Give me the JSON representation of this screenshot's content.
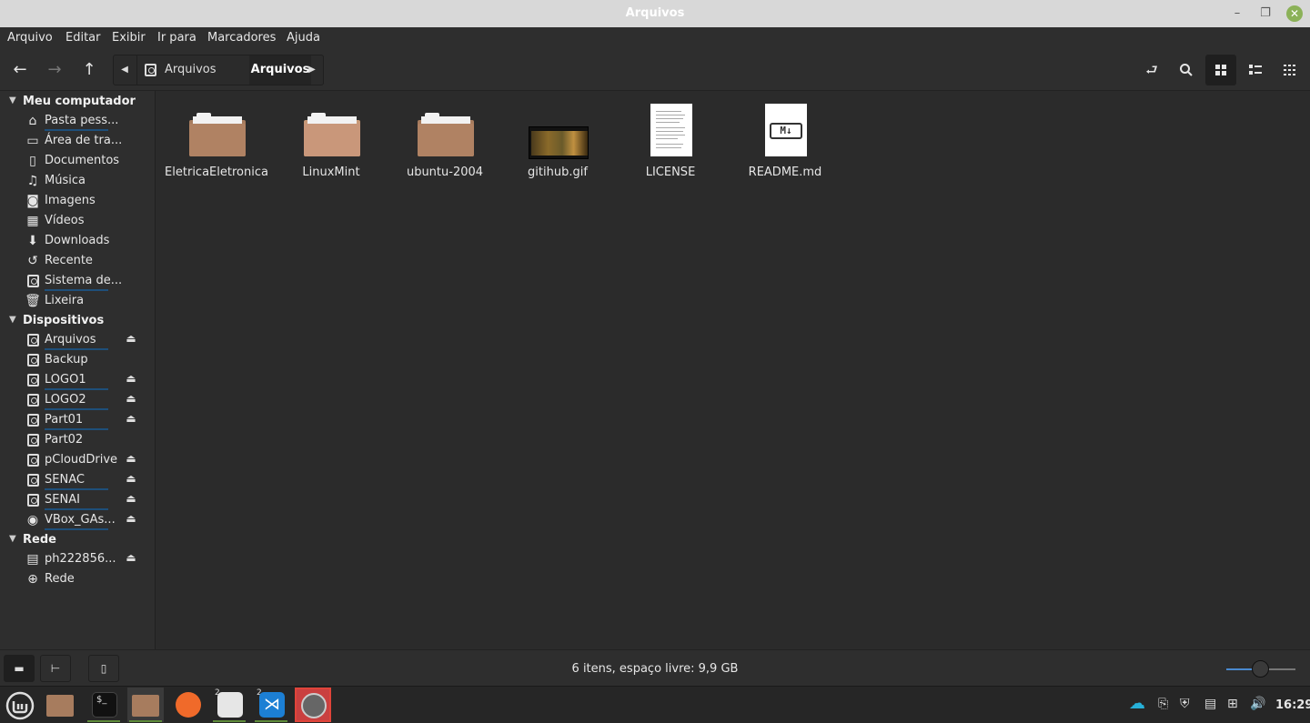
{
  "window": {
    "title": "Arquivos"
  },
  "menu": [
    "Arquivo",
    "Editar",
    "Exibir",
    "Ir para",
    "Marcadores",
    "Ajuda"
  ],
  "pathbar": {
    "segments": [
      "Arquivos",
      "Arquivos"
    ]
  },
  "sidebar": {
    "sections": [
      {
        "label": "Meu computador",
        "items": [
          {
            "label": "Pasta pess...",
            "icon": "home-icon"
          },
          {
            "label": "Área de tra...",
            "icon": "desktop-icon"
          },
          {
            "label": "Documentos",
            "icon": "documents-icon"
          },
          {
            "label": "Música",
            "icon": "music-icon"
          },
          {
            "label": "Imagens",
            "icon": "camera-icon"
          },
          {
            "label": "Vídeos",
            "icon": "video-icon"
          },
          {
            "label": "Downloads",
            "icon": "download-icon"
          },
          {
            "label": "Recente",
            "icon": "history-icon"
          },
          {
            "label": "Sistema de...",
            "icon": "drive-icon"
          },
          {
            "label": "Lixeira",
            "icon": "trash-icon"
          }
        ]
      },
      {
        "label": "Dispositivos",
        "items": [
          {
            "label": "Arquivos",
            "icon": "drive-icon"
          },
          {
            "label": "Backup",
            "icon": "drive-icon"
          },
          {
            "label": "LOGO1",
            "icon": "drive-icon"
          },
          {
            "label": "LOGO2",
            "icon": "drive-icon"
          },
          {
            "label": "Part01",
            "icon": "drive-icon"
          },
          {
            "label": "Part02",
            "icon": "drive-icon"
          },
          {
            "label": "pCloudDrive",
            "icon": "drive-icon"
          },
          {
            "label": "SENAC",
            "icon": "drive-icon"
          },
          {
            "label": "SENAI",
            "icon": "drive-icon"
          },
          {
            "label": "VBox_GAs...",
            "icon": "optical-disc-icon"
          }
        ]
      },
      {
        "label": "Rede",
        "items": [
          {
            "label": "ph222856...",
            "icon": "server-icon"
          },
          {
            "label": "Rede",
            "icon": "network-icon"
          }
        ]
      }
    ]
  },
  "files": [
    {
      "name": "EletricaEletronica",
      "type": "folder"
    },
    {
      "name": "LinuxMint",
      "type": "folder"
    },
    {
      "name": "ubuntu-2004",
      "type": "folder"
    },
    {
      "name": "gitihub.gif",
      "type": "image"
    },
    {
      "name": "LICENSE",
      "type": "text"
    },
    {
      "name": "README.md",
      "type": "markdown"
    }
  ],
  "status": {
    "text": "6 itens, espaço livre: 9,9 GB"
  },
  "taskbar": {
    "clock": "16:29",
    "badges": [
      "2",
      "2"
    ]
  }
}
